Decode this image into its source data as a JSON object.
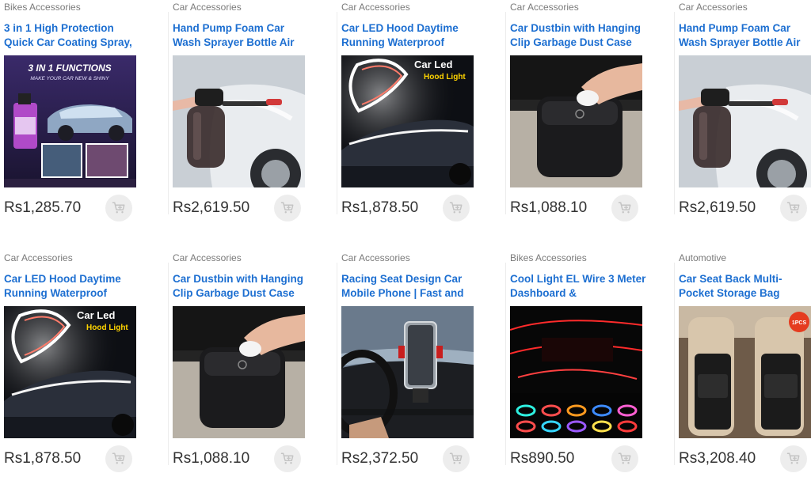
{
  "products": [
    {
      "category": "Bikes Accessories",
      "title": "3 in 1 High Protection Quick Car Coating Spray,",
      "price": "Rs1,285.70",
      "image": "coating-spray",
      "image_text": [
        "3 IN 1 FUNCTIONS",
        "MAKE YOUR CAR NEW & SHINY"
      ]
    },
    {
      "category": "Car Accessories",
      "title": "Hand Pump Foam Car Wash Sprayer Bottle Air",
      "price": "Rs2,619.50",
      "image": "foam-sprayer",
      "image_text": []
    },
    {
      "category": "Car Accessories",
      "title": "Car LED Hood Daytime Running Waterproof",
      "price": "Rs1,878.50",
      "image": "led-hood",
      "image_text": [
        "Car Led",
        "Hood Light"
      ]
    },
    {
      "category": "Car Accessories",
      "title": "Car Dustbin with Hanging Clip Garbage Dust Case",
      "price": "Rs1,088.10",
      "image": "dustbin",
      "image_text": []
    },
    {
      "category": "Car Accessories",
      "title": "Hand Pump Foam Car Wash Sprayer Bottle Air",
      "price": "Rs2,619.50",
      "image": "foam-sprayer",
      "image_text": []
    },
    {
      "category": "Car Accessories",
      "title": "Car LED Hood Daytime Running Waterproof",
      "price": "Rs1,878.50",
      "image": "led-hood",
      "image_text": [
        "Car Led",
        "Hood Light"
      ]
    },
    {
      "category": "Car Accessories",
      "title": "Car Dustbin with Hanging Clip Garbage Dust Case",
      "price": "Rs1,088.10",
      "image": "dustbin",
      "image_text": []
    },
    {
      "category": "Car Accessories",
      "title": "Racing Seat Design Car Mobile Phone | Fast and",
      "price": "Rs2,372.50",
      "image": "phone-holder",
      "image_text": []
    },
    {
      "category": "Bikes Accessories",
      "title": "Cool Light EL Wire 3 Meter Dashboard &",
      "price": "Rs890.50",
      "image": "el-wire",
      "image_text": []
    },
    {
      "category": "Automotive",
      "title": "Car Seat Back Multi-Pocket Storage Bag",
      "price": "Rs3,208.40",
      "image": "seat-organizer",
      "image_text": [
        "1PCS"
      ]
    }
  ],
  "colors": {
    "title": "#1d6fd1",
    "category": "#7a7a7a",
    "price": "#333333",
    "cart_button": "#ededed",
    "cart_icon": "#c4c4c4"
  },
  "icons": {
    "cart": "add-to-cart-icon"
  }
}
